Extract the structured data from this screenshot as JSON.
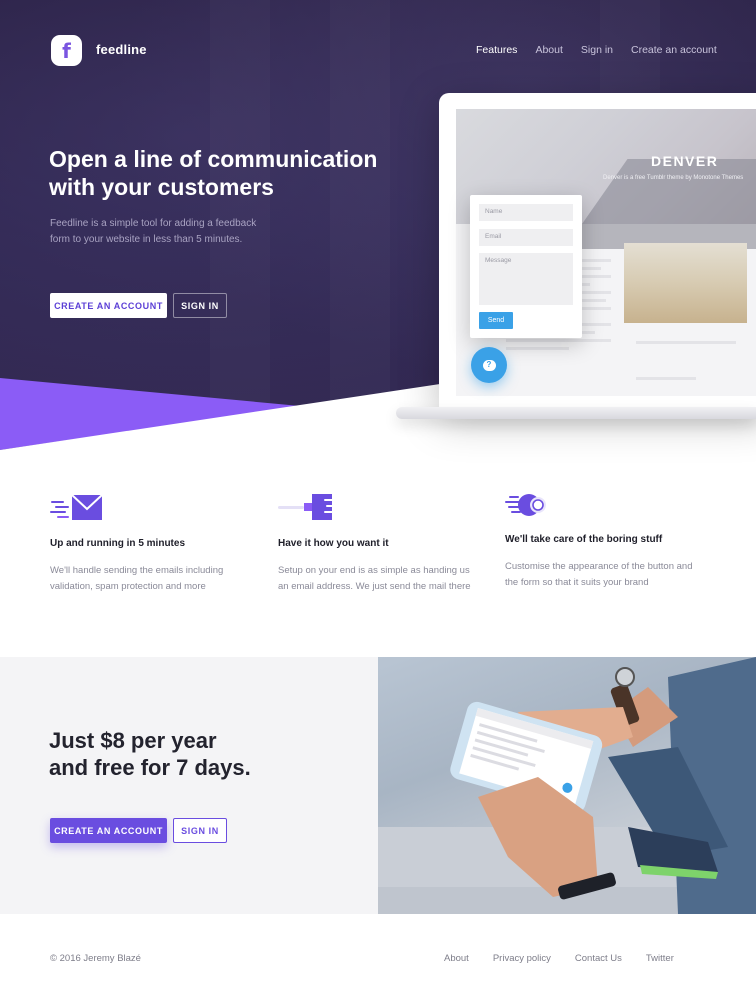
{
  "brand": {
    "name": "feedline",
    "logo_letter": "f"
  },
  "nav": {
    "items": [
      "Features",
      "About",
      "Sign in",
      "Create an account"
    ],
    "active": "Features"
  },
  "hero": {
    "title_line1": "Open a line of communication",
    "title_line2": "with your customers",
    "subtitle": "Feedline is a simple tool for adding a feedback form to your website in less than 5 minutes.",
    "primary_button": "CREATE AN ACCOUNT",
    "secondary_button": "SIGN IN"
  },
  "mockup": {
    "site_title": "DENVER",
    "site_tagline": "Denver is a free Tumblr theme by Monotone Themes",
    "form": {
      "name_placeholder": "Name",
      "email_placeholder": "Email",
      "message_placeholder": "Message",
      "send_label": "Send"
    },
    "bubble_icon": "chat-question-icon"
  },
  "features": [
    {
      "icon": "envelope-speed-icon",
      "title": "Up and running in 5 minutes",
      "text": "We'll handle sending the emails including validation, spam protection and more"
    },
    {
      "icon": "plug-speed-icon",
      "title": "Have it how you want it",
      "text": "Setup on your end is as simple as handing us an email address. We just send the mail there"
    },
    {
      "icon": "gear-speed-icon",
      "title": "We'll take care of the boring stuff",
      "text": "Customise the appearance of the button and the form so that it suits your brand"
    }
  ],
  "pricing": {
    "title_line1": "Just $8 per year",
    "title_line2": "and free for 7 days.",
    "primary_button": "CREATE AN ACCOUNT",
    "secondary_button": "SIGN IN"
  },
  "footer": {
    "copyright": "© 2016 Jeremy Blazé",
    "links": [
      "About",
      "Privacy policy",
      "Contact Us",
      "Twitter"
    ]
  },
  "colors": {
    "accent": "#6a4de0",
    "accent_light": "#8b5cf6",
    "hero_bg": "#2e2650",
    "send_blue": "#3aa1e7"
  }
}
